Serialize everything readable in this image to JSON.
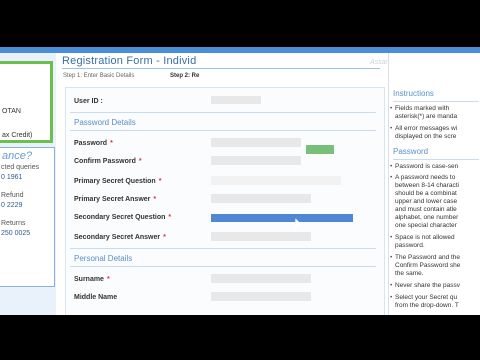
{
  "title": "Registration Form - Individ",
  "steps": [
    "Step 1: Enter Basic Details",
    "Step 2: Re"
  ],
  "watermark": "AssamShayTok",
  "left": {
    "box_lines": [
      "OTAN",
      "ax Credit)"
    ],
    "help_title": "ance?",
    "help_lines": [
      "cted queries",
      "0 1961",
      "Refund",
      "0 2229",
      "Returns",
      "250 0025"
    ]
  },
  "form": {
    "user_id_label": "User ID :",
    "password_section": "Password Details",
    "password_label": "Password",
    "confirm_password_label": "Confirm Password",
    "primary_q_label": "Primary Secret Question",
    "primary_a_label": "Primary Secret Answer",
    "secondary_q_label": "Secondary Secret Question",
    "secondary_a_label": "Secondary Secret Answer",
    "personal_section": "Personal Details",
    "surname_label": "Surname",
    "middle_label": "Middle Name",
    "star": "*"
  },
  "right": {
    "instructions_title": "Instructions",
    "instructions": [
      "Fields marked with",
      "asterisk(*) are manda",
      "All error messages wi",
      "displayed on the scre"
    ],
    "password_title": "Password",
    "password_notes": [
      "Password is case-sen",
      "A password needs to",
      "between 8-14 characti",
      "should be a combinat",
      "upper and lower case",
      "and must contain atle",
      "alphabet, one number",
      "one special character",
      "Space is not allowed",
      "password.",
      "The Password and the",
      "Confirm Password she",
      "the same.",
      "Never share the passv",
      "Select your Secret qu",
      "from the drop-down. T"
    ]
  },
  "colors": {
    "accent": "#3a6ea5",
    "green": "#6cbf4a",
    "select": "#4f86d6"
  }
}
